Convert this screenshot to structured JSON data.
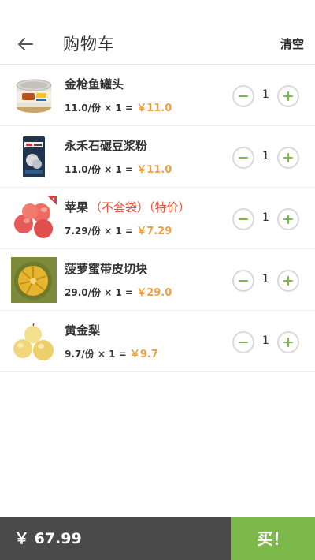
{
  "header": {
    "title": "购物车",
    "clear_label": "清空"
  },
  "items": [
    {
      "name": "金枪鱼罐头",
      "tag": "",
      "unit_price": "11.0/份",
      "times": "× 1 =",
      "subtotal": "￥11.0",
      "quantity": "1",
      "image": "canned-tuna"
    },
    {
      "name": "永禾石碾豆浆粉",
      "tag": "",
      "unit_price": "11.0/份",
      "times": "× 1 =",
      "subtotal": "￥11.0",
      "quantity": "1",
      "image": "soy-milk-powder"
    },
    {
      "name": "苹果",
      "tag": "（不套袋）（特价）",
      "unit_price": "7.29/份",
      "times": "× 1 =",
      "subtotal": "￥7.29",
      "quantity": "1",
      "image": "apples"
    },
    {
      "name": "菠萝蜜带皮切块",
      "tag": "",
      "unit_price": "29.0/份",
      "times": "× 1 =",
      "subtotal": "￥29.0",
      "quantity": "1",
      "image": "jackfruit"
    },
    {
      "name": "黄金梨",
      "tag": "",
      "unit_price": "9.7/份",
      "times": "× 1 =",
      "subtotal": "￥9.7",
      "quantity": "1",
      "image": "golden-pears"
    }
  ],
  "footer": {
    "total": "￥ 67.99",
    "buy_label": "买！"
  },
  "colors": {
    "accent_green": "#7cb84a",
    "price_orange": "#f0a046",
    "special_red": "#e8503a",
    "footer_dark": "#4a4a4a"
  }
}
